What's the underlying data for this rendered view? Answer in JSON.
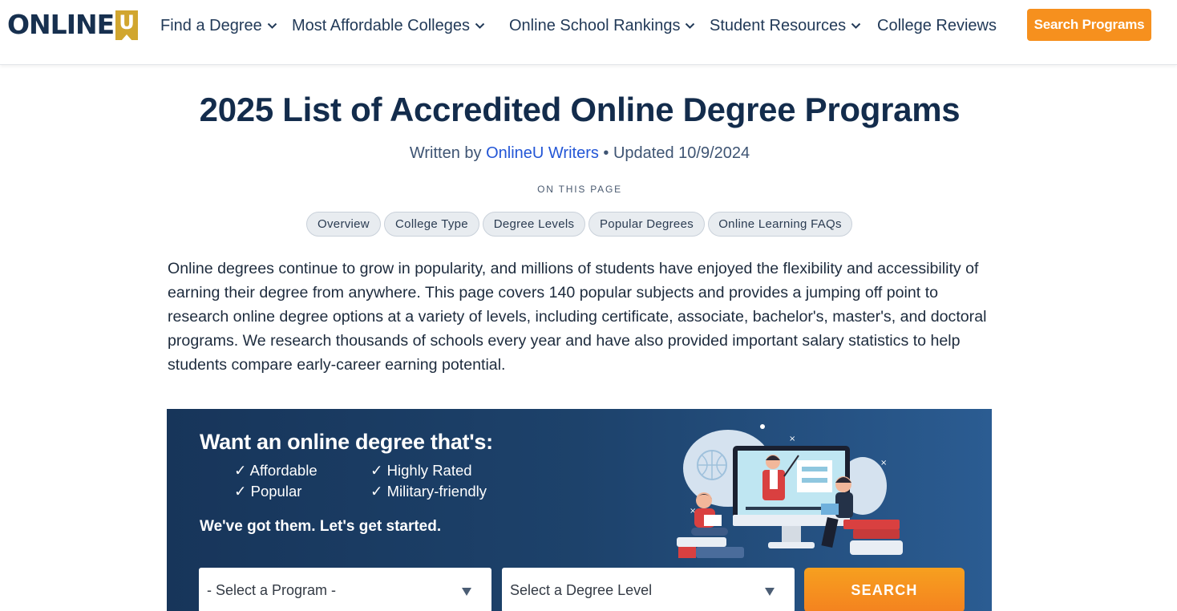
{
  "header": {
    "logo_text": "ONLINE",
    "logo_badge": "U",
    "nav": [
      {
        "label": "Find a Degree",
        "has_dropdown": true
      },
      {
        "label": "Most Affordable Colleges",
        "has_dropdown": true
      },
      {
        "label": "Online School Rankings",
        "has_dropdown": true
      },
      {
        "label": "Student Resources",
        "has_dropdown": true
      },
      {
        "label": "College Reviews",
        "has_dropdown": false
      }
    ],
    "cta_label": "Search Programs"
  },
  "article": {
    "title": "2025 List of Accredited Online Degree Programs",
    "byline_prefix": "Written by ",
    "byline_author": "OnlineU Writers",
    "byline_suffix": " • Updated 10/9/2024",
    "toc_label": "ON THIS PAGE",
    "toc": [
      "Overview",
      "College Type",
      "Degree Levels",
      "Popular Degrees",
      "Online Learning FAQs"
    ],
    "intro": "Online degrees continue to grow in popularity, and millions of students have enjoyed the flexibility and accessibility of earning their degree from anywhere. This page covers 140 popular subjects and provides a jumping off point to research online degree options at a variety of levels, including certificate, associate, bachelor's, master's, and doctoral programs. We research thousands of schools every year and have also provided important salary statistics to help students compare early-career earning potential."
  },
  "promo": {
    "heading": "Want an online degree that's:",
    "checks": [
      "✓ Affordable",
      "✓ Highly Rated",
      "✓ Popular",
      "✓ Military-friendly"
    ],
    "cta_text": "We've got them. Let's get started.",
    "program_select": "- Select a Program -",
    "degree_select": "Select a Degree Level",
    "search_label": "SEARCH"
  },
  "colors": {
    "navy": "#132c4c",
    "link_blue": "#2356d6",
    "orange": "#f6901e",
    "logo_gold": "#d1a62f",
    "promo_bg": "#1d426b"
  },
  "icons": [
    "chevron-down-icon",
    "caret-down-icon",
    "checkmark-icon"
  ]
}
